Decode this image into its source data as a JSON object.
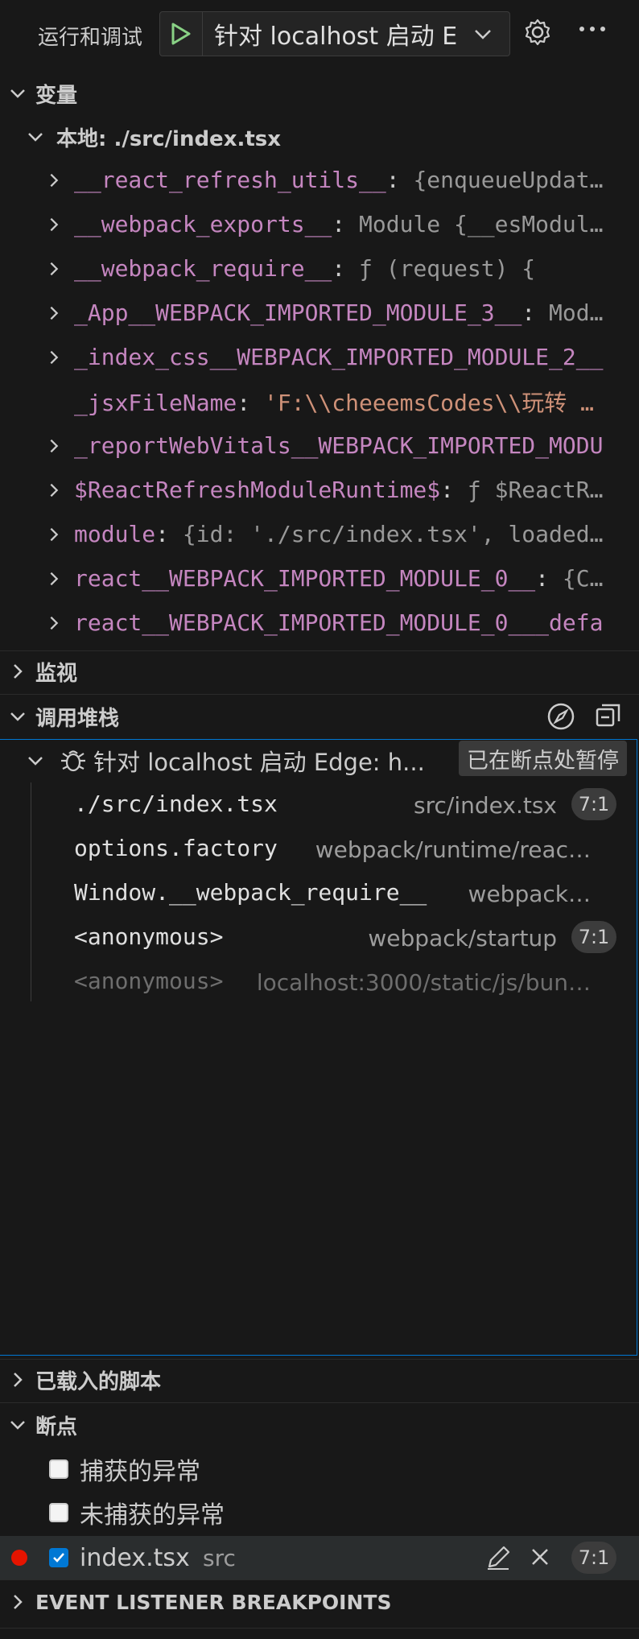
{
  "toolbar": {
    "title": "运行和调试",
    "launch_config": "针对 localhost 启动 E",
    "play_icon": "play-icon",
    "settings_icon": "gear-icon",
    "more_icon": "ellipsis-icon"
  },
  "variables": {
    "header": "变量",
    "scope": "本地: ./src/index.tsx",
    "items": [
      {
        "name": "__react_refresh_utils__",
        "sep": ": ",
        "value": "{enqueueUpdat…",
        "expandable": true,
        "kind": "obj"
      },
      {
        "name": "__webpack_exports__",
        "sep": ": ",
        "value": "Module {__esModul…",
        "expandable": true,
        "kind": "obj"
      },
      {
        "name": "__webpack_require__",
        "sep": ": ",
        "value": "ƒ (request) {",
        "expandable": true,
        "kind": "obj"
      },
      {
        "name": "_App__WEBPACK_IMPORTED_MODULE_3__",
        "sep": ": ",
        "value": "Mod…",
        "expandable": true,
        "kind": "obj"
      },
      {
        "name": "_index_css__WEBPACK_IMPORTED_MODULE_2__",
        "sep": "",
        "value": "",
        "expandable": true,
        "kind": "obj"
      },
      {
        "name": "_jsxFileName",
        "sep": ": ",
        "value": "'F:\\\\cheeemsCodes\\\\玩转 …",
        "expandable": false,
        "kind": "str"
      },
      {
        "name": "_reportWebVitals__WEBPACK_IMPORTED_MODU",
        "sep": "",
        "value": "",
        "expandable": true,
        "kind": "obj"
      },
      {
        "name": "$ReactRefreshModuleRuntime$",
        "sep": ": ",
        "value": "ƒ $ReactR…",
        "expandable": true,
        "kind": "obj"
      },
      {
        "name": "module",
        "sep": ": ",
        "value": "{id: './src/index.tsx', loaded…",
        "expandable": true,
        "kind": "obj"
      },
      {
        "name": "react__WEBPACK_IMPORTED_MODULE_0__",
        "sep": ": ",
        "value": "{C…",
        "expandable": true,
        "kind": "obj"
      },
      {
        "name": "react__WEBPACK_IMPORTED_MODULE_0___defa",
        "sep": "",
        "value": "",
        "expandable": true,
        "kind": "obj"
      }
    ]
  },
  "watch": {
    "header": "监视"
  },
  "callstack": {
    "header": "调用堆栈",
    "session_name": "针对 localhost 启动 Edge: h...",
    "paused_label": "已在断点处暂停",
    "frames": [
      {
        "name": "./src/index.tsx",
        "source": "src/index.tsx",
        "position": "7:1",
        "dim": false
      },
      {
        "name": "options.factory",
        "source": "webpack/runtime/reac…",
        "position": "",
        "dim": false
      },
      {
        "name": "Window.__webpack_require__",
        "source": "webpack…",
        "position": "",
        "dim": false
      },
      {
        "name": "<anonymous>",
        "source": "webpack/startup",
        "position": "7:1",
        "dim": false
      },
      {
        "name": "<anonymous>",
        "source": "localhost:3000/static/js/bun…",
        "position": "",
        "dim": true
      }
    ]
  },
  "loaded_scripts": {
    "header": "已载入的脚本"
  },
  "breakpoints": {
    "header": "断点",
    "items": [
      {
        "label": "捕获的异常",
        "checked": false
      },
      {
        "label": "未捕获的异常",
        "checked": false
      }
    ],
    "file_breakpoint": {
      "file": "index.tsx",
      "folder": "src",
      "position": "7:1",
      "checked": true
    }
  },
  "event_listener": {
    "header": "EVENT LISTENER BREAKPOINTS"
  },
  "colors": {
    "accent": "#0078d4",
    "breakpoint": "#e51400",
    "variable_name": "#c586c0",
    "string_value": "#ce9178"
  }
}
